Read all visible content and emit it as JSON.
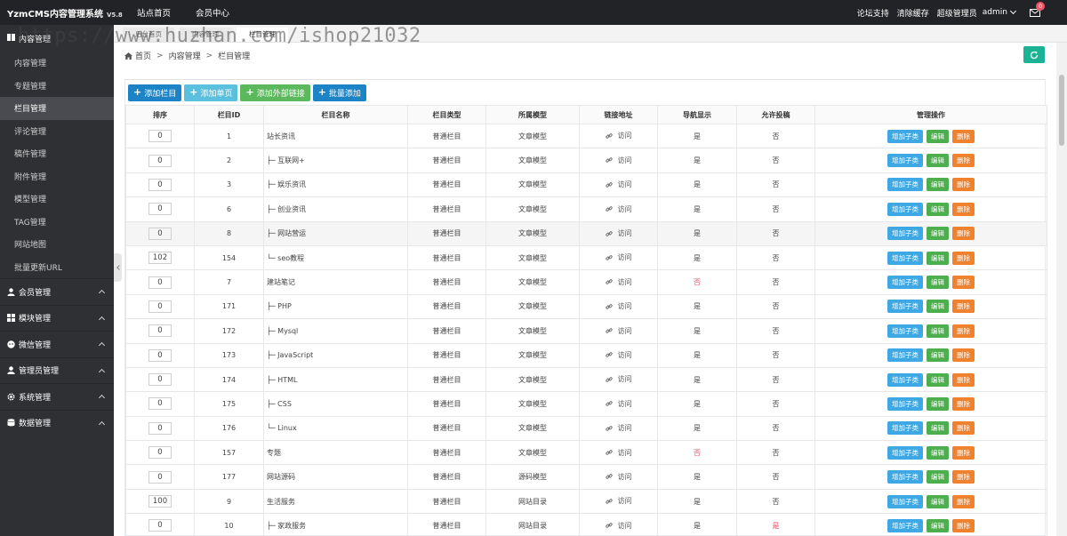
{
  "app": {
    "name": "YzmCMS内容管理系统",
    "version": "V5.8"
  },
  "topnav": [
    "站点首页",
    "会员中心"
  ],
  "topright": {
    "links": [
      "论坛支持",
      "清除缓存",
      "超级管理员"
    ],
    "user": "admin",
    "msg_count": "0"
  },
  "watermark": "https://www.huzhan.com/ishop21032",
  "tabs": [
    "后台首页",
    "内容管理",
    "栏目管理"
  ],
  "sidebar": {
    "section": "内容管理",
    "subs": [
      "内容管理",
      "专题管理",
      "栏目管理",
      "评论管理",
      "稿件管理",
      "附件管理",
      "模型管理",
      "TAG管理",
      "网站地图",
      "批量更新URL"
    ],
    "active_index": 2,
    "groups": [
      {
        "label": "会员管理",
        "icon": "user-icon"
      },
      {
        "label": "模块管理",
        "icon": "grid-icon"
      },
      {
        "label": "微信管理",
        "icon": "wechat-icon"
      },
      {
        "label": "管理员管理",
        "icon": "admin-icon"
      },
      {
        "label": "系统管理",
        "icon": "gear-icon"
      },
      {
        "label": "数据管理",
        "icon": "database-icon"
      }
    ]
  },
  "breadcrumb": [
    "首页",
    "内容管理",
    "栏目管理"
  ],
  "actions": [
    "添加栏目",
    "添加单页",
    "添加外部链接",
    "批量添加"
  ],
  "table": {
    "headers": [
      "排序",
      "栏目ID",
      "栏目名称",
      "栏目类型",
      "所属模型",
      "链接地址",
      "导航显示",
      "允许投稿",
      "管理操作"
    ],
    "visit_label": "访问",
    "op_labels": {
      "sub": "增加子类",
      "edit": "编辑",
      "del": "删除"
    },
    "rows": [
      {
        "sort": "0",
        "id": "1",
        "name": "站长资讯",
        "type": "普通栏目",
        "model": "文章模型",
        "nav": "是",
        "contrib": "否"
      },
      {
        "sort": "0",
        "id": "2",
        "name": "├─ 互联网+",
        "type": "普通栏目",
        "model": "文章模型",
        "nav": "是",
        "contrib": "否"
      },
      {
        "sort": "0",
        "id": "3",
        "name": "├─ 娱乐资讯",
        "type": "普通栏目",
        "model": "文章模型",
        "nav": "是",
        "contrib": "否"
      },
      {
        "sort": "0",
        "id": "6",
        "name": "├─ 创业资讯",
        "type": "普通栏目",
        "model": "文章模型",
        "nav": "是",
        "contrib": "否"
      },
      {
        "sort": "0",
        "id": "8",
        "name": "├─ 网站营运",
        "type": "普通栏目",
        "model": "文章模型",
        "nav": "是",
        "contrib": "否"
      },
      {
        "sort": "102",
        "id": "154",
        "name": "└─ seo教程",
        "type": "普通栏目",
        "model": "文章模型",
        "nav": "是",
        "contrib": "否"
      },
      {
        "sort": "0",
        "id": "7",
        "name": "建站笔记",
        "type": "普通栏目",
        "model": "文章模型",
        "nav": "否",
        "contrib": "否"
      },
      {
        "sort": "0",
        "id": "171",
        "name": "├─ PHP",
        "type": "普通栏目",
        "model": "文章模型",
        "nav": "是",
        "contrib": "否"
      },
      {
        "sort": "0",
        "id": "172",
        "name": "├─ Mysql",
        "type": "普通栏目",
        "model": "文章模型",
        "nav": "是",
        "contrib": "否"
      },
      {
        "sort": "0",
        "id": "173",
        "name": "├─ JavaScript",
        "type": "普通栏目",
        "model": "文章模型",
        "nav": "是",
        "contrib": "否"
      },
      {
        "sort": "0",
        "id": "174",
        "name": "├─ HTML",
        "type": "普通栏目",
        "model": "文章模型",
        "nav": "是",
        "contrib": "否"
      },
      {
        "sort": "0",
        "id": "175",
        "name": "├─ CSS",
        "type": "普通栏目",
        "model": "文章模型",
        "nav": "是",
        "contrib": "否"
      },
      {
        "sort": "0",
        "id": "176",
        "name": "└─ Linux",
        "type": "普通栏目",
        "model": "文章模型",
        "nav": "是",
        "contrib": "否"
      },
      {
        "sort": "0",
        "id": "157",
        "name": "专题",
        "type": "普通栏目",
        "model": "文章模型",
        "nav": "否",
        "contrib": "否"
      },
      {
        "sort": "0",
        "id": "177",
        "name": "网站源码",
        "type": "普通栏目",
        "model": "源码模型",
        "nav": "是",
        "contrib": "否"
      },
      {
        "sort": "100",
        "id": "9",
        "name": "生活服务",
        "type": "普通栏目",
        "model": "网站目录",
        "nav": "是",
        "contrib": "否"
      },
      {
        "sort": "0",
        "id": "10",
        "name": "├─ 家政服务",
        "type": "普通栏目",
        "model": "网站目录",
        "nav": "是",
        "contrib": "是"
      }
    ],
    "highlight_row": 4
  },
  "colors": {
    "topbar": "#222326",
    "sidebar": "#2f3034",
    "primary": "#1c84c6",
    "info": "#5bc0de",
    "success": "#5cb85c",
    "warning": "#f0812d",
    "danger": "#ed5565"
  }
}
